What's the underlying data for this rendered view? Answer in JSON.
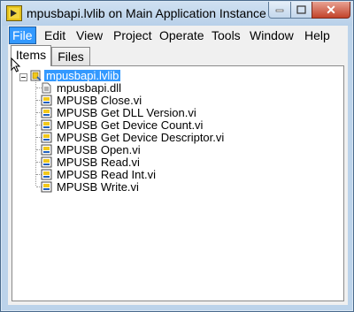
{
  "window": {
    "title": "mpusbapi.lvlib on Main Application Instance",
    "close_glyph": "✕"
  },
  "menu": {
    "items": [
      "File",
      "Edit",
      "View",
      "Project",
      "Operate",
      "Tools",
      "Window",
      "Help"
    ],
    "active": "File"
  },
  "tabs": [
    "Items",
    "Files"
  ],
  "selected_tab": "Items",
  "tree": {
    "root": "mpusbapi.lvlib",
    "children": [
      {
        "label": "mpusbapi.dll",
        "icon": "dll-file-icon"
      },
      {
        "label": "MPUSB Close.vi",
        "icon": "vi-icon"
      },
      {
        "label": "MPUSB Get DLL Version.vi",
        "icon": "vi-icon"
      },
      {
        "label": "MPUSB Get Device Count.vi",
        "icon": "vi-icon"
      },
      {
        "label": "MPUSB Get Device Descriptor.vi",
        "icon": "vi-icon"
      },
      {
        "label": "MPUSB Open.vi",
        "icon": "vi-icon"
      },
      {
        "label": "MPUSB Read.vi",
        "icon": "vi-icon"
      },
      {
        "label": "MPUSB Read Int.vi",
        "icon": "vi-icon"
      },
      {
        "label": "MPUSB Write.vi",
        "icon": "vi-icon"
      }
    ]
  },
  "colors": {
    "selection": "#3399ff",
    "frame": "#bcd3ea",
    "close_button": "#c2432a"
  }
}
